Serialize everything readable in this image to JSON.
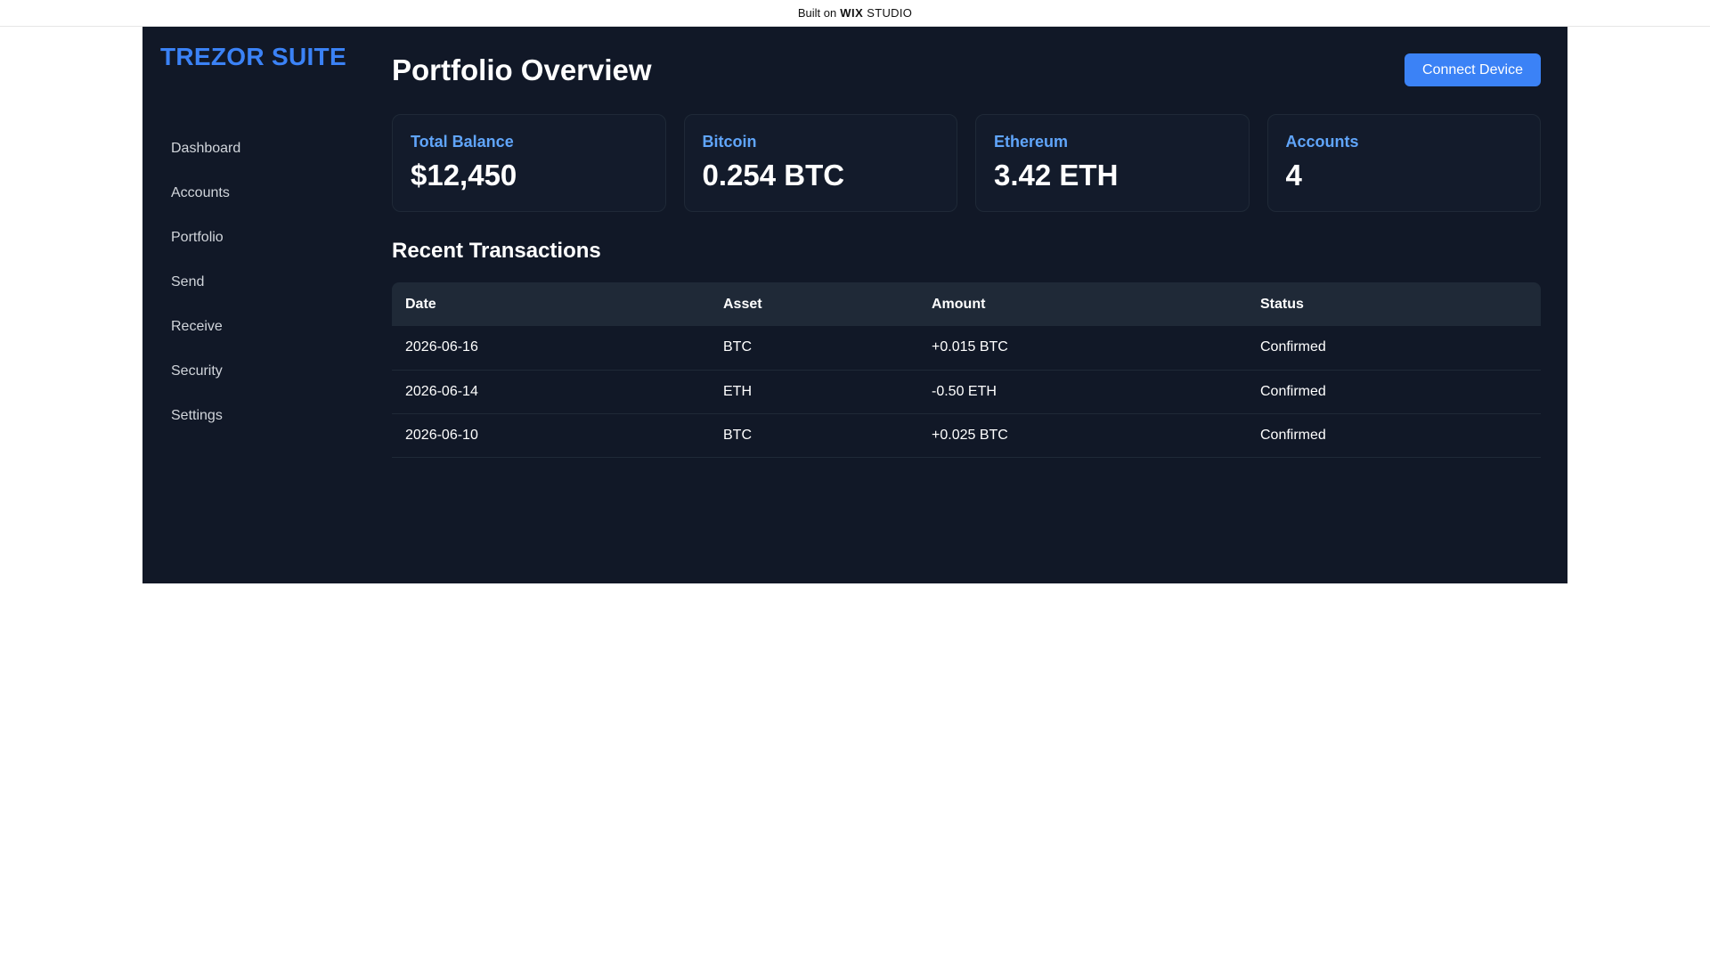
{
  "wix_banner": {
    "prefix": "Built on",
    "brand": "WIX",
    "suffix": "STUDIO"
  },
  "sidebar": {
    "brand": "TREZOR SUITE",
    "items": [
      {
        "label": "Dashboard"
      },
      {
        "label": "Accounts"
      },
      {
        "label": "Portfolio"
      },
      {
        "label": "Send"
      },
      {
        "label": "Receive"
      },
      {
        "label": "Security"
      },
      {
        "label": "Settings"
      }
    ]
  },
  "header": {
    "title": "Portfolio Overview",
    "connect_label": "Connect Device"
  },
  "cards": [
    {
      "label": "Total Balance",
      "value": "$12,450"
    },
    {
      "label": "Bitcoin",
      "value": "0.254 BTC"
    },
    {
      "label": "Ethereum",
      "value": "3.42 ETH"
    },
    {
      "label": "Accounts",
      "value": "4"
    }
  ],
  "transactions": {
    "title": "Recent Transactions",
    "columns": [
      "Date",
      "Asset",
      "Amount",
      "Status"
    ],
    "rows": [
      {
        "date": "2026-06-16",
        "asset": "BTC",
        "amount": "+0.015 BTC",
        "status": "Confirmed"
      },
      {
        "date": "2026-06-14",
        "asset": "ETH",
        "amount": "-0.50 ETH",
        "status": "Confirmed"
      },
      {
        "date": "2026-06-10",
        "asset": "BTC",
        "amount": "+0.025 BTC",
        "status": "Confirmed"
      }
    ]
  },
  "colors": {
    "background": "#111827",
    "accent": "#3b82f6",
    "card_label": "#60a5fa",
    "status_confirmed": "#22c55e"
  }
}
